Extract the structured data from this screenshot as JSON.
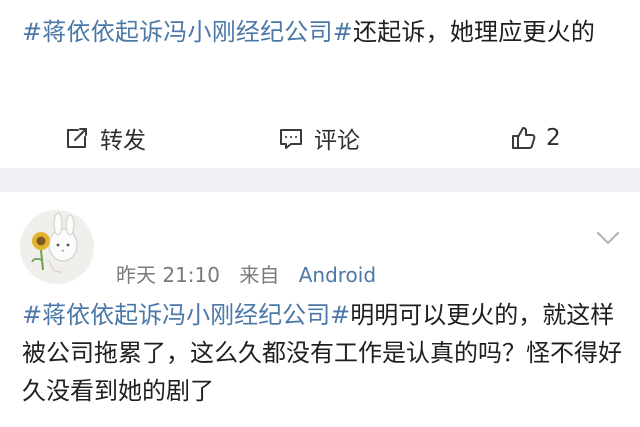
{
  "post": {
    "hashtag": "#蒋依依起诉冯小刚经纪公司#",
    "text": "还起诉，她理应更火的",
    "actions": {
      "repost_label": "转发",
      "comment_label": "评论",
      "like_count": "2"
    }
  },
  "comment": {
    "time": "昨天 21:10",
    "source_prefix": "来自",
    "source_device": "Android",
    "hashtag": "#蒋依依起诉冯小刚经纪公司#",
    "text": "明明可以更火的，就这样被公司拖累了，这么久都没有工作是认真的吗？怪不得好久没看到她的剧了"
  },
  "colors": {
    "link": "#4c78a8",
    "text": "#1f1f1f",
    "muted": "#7a7a7a",
    "separator": "#eff1f4"
  },
  "icons": {
    "repost": "share-edit-icon",
    "comment": "comment-bubble-icon",
    "like": "thumbs-up-icon",
    "expand": "chevron-down-icon"
  }
}
